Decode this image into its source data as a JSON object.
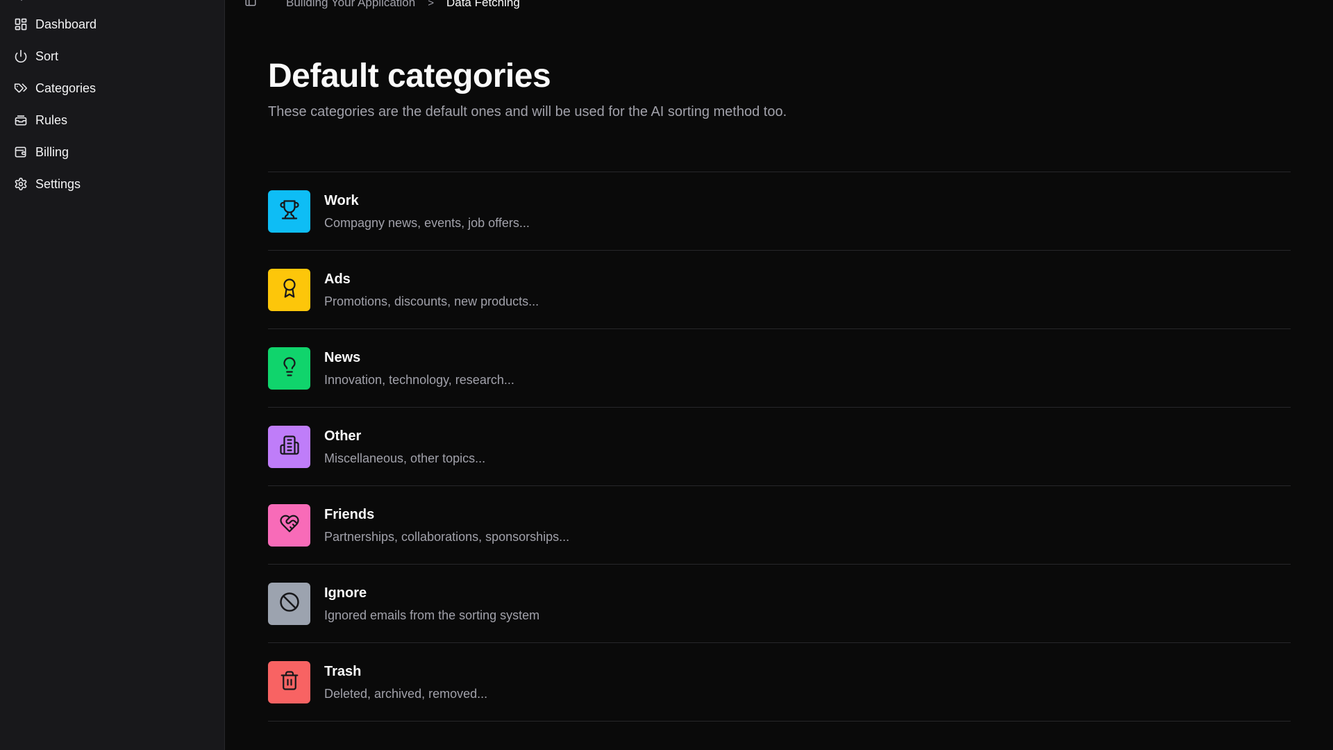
{
  "sidebar": {
    "items": [
      {
        "label": "Dashboard",
        "icon": "dashboard-icon"
      },
      {
        "label": "Sort",
        "icon": "power-icon"
      },
      {
        "label": "Categories",
        "icon": "tags-icon"
      },
      {
        "label": "Rules",
        "icon": "inbox-stack-icon"
      },
      {
        "label": "Billing",
        "icon": "wallet-icon"
      },
      {
        "label": "Settings",
        "icon": "gear-icon"
      }
    ]
  },
  "breadcrumb": {
    "parent": "Building Your Application",
    "separator": ">",
    "current": "Data Fetching"
  },
  "page": {
    "title": "Default categories",
    "subtitle": "These categories are the default ones and will be used for the AI sorting method too."
  },
  "categories": [
    {
      "name": "Work",
      "description": "Compagny news, events, job offers...",
      "color": "#0ebdf5",
      "icon": "trophy-icon"
    },
    {
      "name": "Ads",
      "description": "Promotions, discounts, new products...",
      "color": "#fdc60a",
      "icon": "award-ribbon-icon"
    },
    {
      "name": "News",
      "description": "Innovation, technology, research...",
      "color": "#10d46c",
      "icon": "lightbulb-icon"
    },
    {
      "name": "Other",
      "description": "Miscellaneous, other topics...",
      "color": "#bf7df9",
      "icon": "building-icon"
    },
    {
      "name": "Friends",
      "description": "Partnerships, collaborations, sponsorships...",
      "color": "#f86bb8",
      "icon": "heart-handshake-icon"
    },
    {
      "name": "Ignore",
      "description": "Ignored emails from the sorting system",
      "color": "#9ca3af",
      "icon": "ban-icon"
    },
    {
      "name": "Trash",
      "description": "Deleted, archived, removed...",
      "color": "#f86363",
      "icon": "trash-icon"
    }
  ]
}
